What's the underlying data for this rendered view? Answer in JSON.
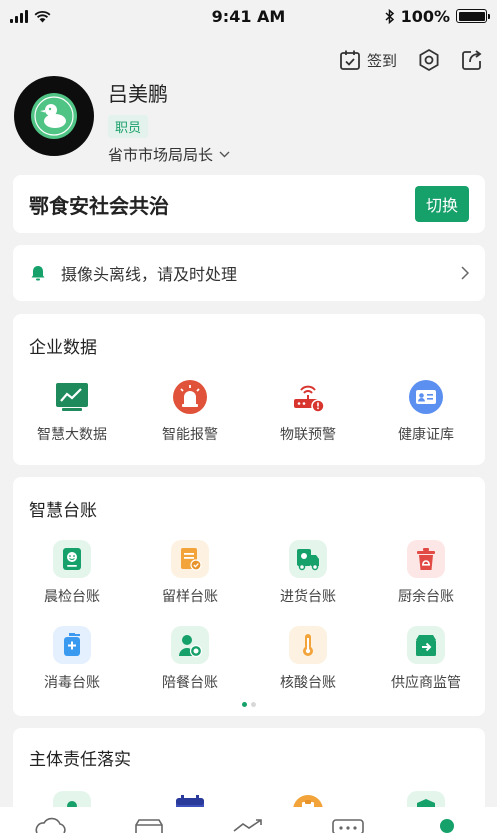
{
  "status_bar": {
    "time": "9:41 AM",
    "battery": "100%"
  },
  "header": {
    "checkin_label": "签到"
  },
  "profile": {
    "name": "吕美鹏",
    "role": "职员",
    "position": "省市市场局局长"
  },
  "org": {
    "name": "鄂食安社会共治",
    "switch_label": "切换"
  },
  "alert": {
    "text": "摄像头离线，请及时处理"
  },
  "enterprise": {
    "title": "企业数据",
    "items": [
      {
        "label": "智慧大数据",
        "icon": "chart-icon",
        "color": "#1f8a5b"
      },
      {
        "label": "智能报警",
        "icon": "alarm-icon",
        "color": "#e0523a"
      },
      {
        "label": "物联预警",
        "icon": "router-icon",
        "color": "#d9352f"
      },
      {
        "label": "健康证库",
        "icon": "id-card-icon",
        "color": "#5b8ff0"
      }
    ]
  },
  "ledger": {
    "title": "智慧台账",
    "items": [
      {
        "label": "晨检台账",
        "icon": "face-check-icon",
        "color": "#16a06a"
      },
      {
        "label": "留样台账",
        "icon": "sample-icon",
        "color": "#f2a43a"
      },
      {
        "label": "进货台账",
        "icon": "truck-icon",
        "color": "#16a06a"
      },
      {
        "label": "厨余台账",
        "icon": "trash-icon",
        "color": "#e24b45"
      },
      {
        "label": "消毒台账",
        "icon": "disinfect-icon",
        "color": "#3a9af0"
      },
      {
        "label": "陪餐台账",
        "icon": "meal-icon",
        "color": "#16a06a"
      },
      {
        "label": "核酸台账",
        "icon": "thermometer-icon",
        "color": "#f2a43a"
      },
      {
        "label": "供应商监管",
        "icon": "supplier-icon",
        "color": "#16a06a"
      }
    ],
    "page_count": 2,
    "active_page": 0
  },
  "responsibility": {
    "title": "主体责任落实"
  }
}
